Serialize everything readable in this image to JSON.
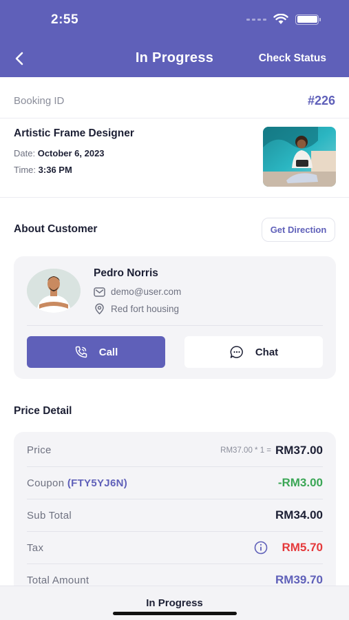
{
  "status_bar": {
    "time": "2:55"
  },
  "nav": {
    "title": "In Progress",
    "action_label": "Check Status",
    "back_icon": "chevron-left-icon"
  },
  "booking": {
    "id_label": "Booking ID",
    "id_value": "#226"
  },
  "service": {
    "name": "Artistic Frame Designer",
    "date_label": "Date:",
    "date_value": "October 6, 2023",
    "time_label": "Time:",
    "time_value": "3:36 PM"
  },
  "customer": {
    "section_title": "About Customer",
    "direction_label": "Get Direction",
    "name": "Pedro Norris",
    "email": "demo@user.com",
    "address": "Red fort housing",
    "call_label": "Call",
    "chat_label": "Chat"
  },
  "price": {
    "section_title": "Price Detail",
    "rows": {
      "price": {
        "label": "Price",
        "calc": "RM37.00 * 1 =",
        "value": "RM37.00"
      },
      "coupon": {
        "label": "Coupon",
        "code": "(FTY5YJ6N)",
        "value": "-RM3.00"
      },
      "subtotal": {
        "label": "Sub Total",
        "value": "RM34.00"
      },
      "tax": {
        "label": "Tax",
        "value": "RM5.70"
      },
      "total": {
        "label": "Total Amount",
        "value": "RM39.70"
      }
    }
  },
  "bottom": {
    "status_label": "In Progress"
  },
  "colors": {
    "primary": "#5f60b9",
    "discount": "#3aa655",
    "tax": "#e5393b",
    "card_bg": "#f4f4f7"
  }
}
